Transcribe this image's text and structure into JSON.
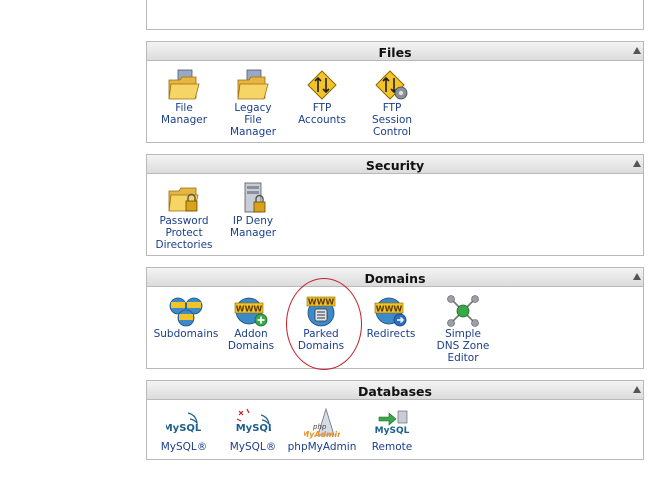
{
  "sections": {
    "files": {
      "title": "Files",
      "items": [
        {
          "label": "File\nManager"
        },
        {
          "label": "Legacy\nFile\nManager"
        },
        {
          "label": "FTP\nAccounts"
        },
        {
          "label": "FTP\nSession\nControl"
        }
      ]
    },
    "security": {
      "title": "Security",
      "items": [
        {
          "label": "Password\nProtect\nDirectories"
        },
        {
          "label": "IP Deny\nManager"
        }
      ]
    },
    "domains": {
      "title": "Domains",
      "items": [
        {
          "label": "Subdomains"
        },
        {
          "label": "Addon\nDomains"
        },
        {
          "label": "Parked\nDomains"
        },
        {
          "label": "Redirects"
        },
        {
          "label": "Simple\nDNS Zone\nEditor"
        }
      ]
    },
    "databases": {
      "title": "Databases",
      "items": [
        {
          "label": "MySQL®"
        },
        {
          "label": "MySQL®"
        },
        {
          "label": "phpMyAdmin"
        },
        {
          "label": "Remote"
        }
      ]
    }
  },
  "icon_text": {
    "www": "WWW",
    "mysql": "MySQL",
    "php": "php",
    "myadmin": "MyAdmin"
  },
  "colors": {
    "highlight": "#c0202a",
    "link": "#1b3f8b"
  }
}
